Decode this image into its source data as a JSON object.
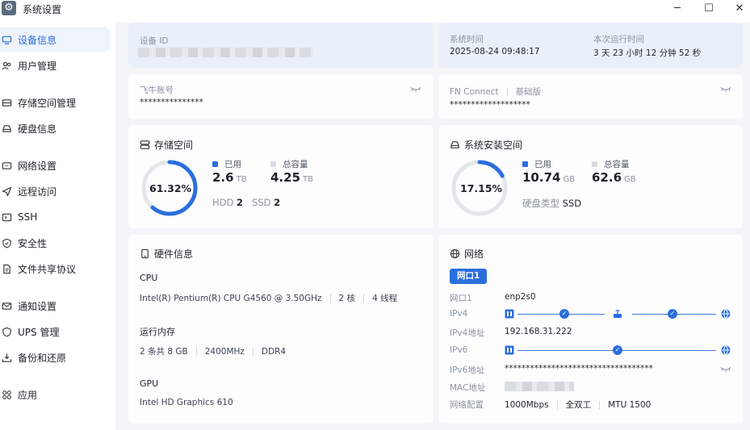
{
  "window": {
    "title": "系统设置"
  },
  "sidebar": {
    "items": [
      {
        "label": "设备信息",
        "icon": "monitor-icon",
        "active": true
      },
      {
        "label": "用户管理",
        "icon": "users-icon"
      },
      {
        "label": "存储空间管理",
        "icon": "storage-icon"
      },
      {
        "label": "硬盘信息",
        "icon": "disk-icon"
      },
      {
        "label": "网络设置",
        "icon": "network-icon"
      },
      {
        "label": "远程访问",
        "icon": "send-icon"
      },
      {
        "label": "SSH",
        "icon": "terminal-icon"
      },
      {
        "label": "安全性",
        "icon": "shield-icon"
      },
      {
        "label": "文件共享协议",
        "icon": "file-icon"
      },
      {
        "label": "通知设置",
        "icon": "mail-icon"
      },
      {
        "label": "UPS 管理",
        "icon": "power-icon"
      },
      {
        "label": "备份和还原",
        "icon": "backup-icon"
      },
      {
        "label": "应用",
        "icon": "apps-icon"
      }
    ]
  },
  "device": {
    "id_label": "设备 ID",
    "time_label": "系统时间",
    "time_value": "2025-08-24 09:48:17",
    "uptime_label": "本次运行时间",
    "uptime_value": "3 天 23 小时 12 分钟 52 秒"
  },
  "account": {
    "label": "飞牛账号",
    "value": "***************",
    "fn_label": "FN Connect",
    "fn_edition": "基础版",
    "fn_value": "*******************"
  },
  "storage": {
    "title": "存储空间",
    "percent_text": "61.32%",
    "percent": 61.32,
    "used_label": "已用",
    "used_value": "2.6",
    "used_unit": "TB",
    "total_label": "总容量",
    "total_value": "4.25",
    "total_unit": "TB",
    "hdd_label": "HDD",
    "hdd_count": "2",
    "ssd_label": "SSD",
    "ssd_count": "2"
  },
  "system_storage": {
    "title": "系统安装空间",
    "percent_text": "17.15%",
    "percent": 17.15,
    "used_label": "已用",
    "used_value": "10.74",
    "used_unit": "GB",
    "total_label": "总容量",
    "total_value": "62.6",
    "total_unit": "GB",
    "disk_type_label": "硬盘类型",
    "disk_type_value": "SSD"
  },
  "hardware": {
    "title": "硬件信息",
    "cpu_label": "CPU",
    "cpu_model": "Intel(R) Pentium(R) CPU G4560 @ 3.50GHz",
    "cpu_cores": "2 核",
    "cpu_threads": "4 线程",
    "mem_label": "运行内存",
    "mem_config": "2 条共 8 GB",
    "mem_freq": "2400MHz",
    "mem_type": "DDR4",
    "gpu_label": "GPU",
    "gpu_model": "Intel HD Graphics 610"
  },
  "network": {
    "title": "网络",
    "port_tab": "网口1",
    "port_label": "网口1",
    "port_value": "enp2s0",
    "ipv4_label": "IPv4",
    "ipv4_addr_label": "IPv4地址",
    "ipv4_addr_value": "192.168.31.222",
    "ipv6_label": "IPv6",
    "ipv6_addr_label": "IPv6地址",
    "ipv6_addr_value": "***********************************",
    "mac_label": "MAC地址",
    "config_label": "网络配置",
    "speed": "1000Mbps",
    "duplex": "全双工",
    "mtu": "MTU 1500"
  },
  "colors": {
    "accent": "#2a6fdc",
    "ring_track": "#e3e6ea"
  }
}
